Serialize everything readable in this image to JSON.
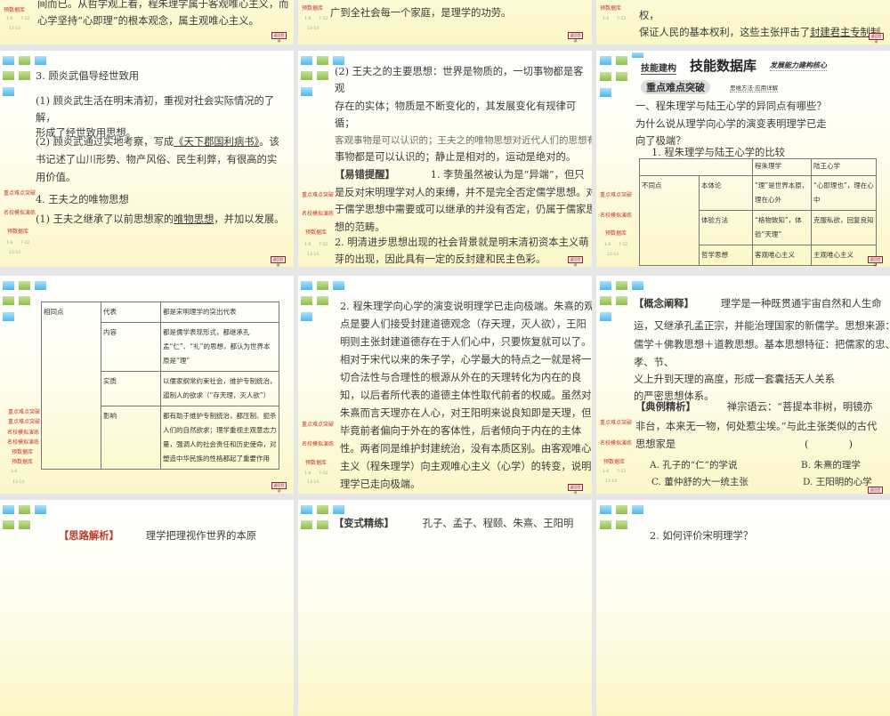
{
  "nav": {
    "key": "重点难点突破",
    "mock": "名校模拟演练",
    "bank": "预数据库",
    "p1": "1-6",
    "p2": "7-12",
    "p3": "13-14",
    "return": "返回目录"
  },
  "s0a": {
    "l1": "间而已。从哲学观上看，程朱理学属于客观唯心主义，而",
    "l2": "心学坚持“心即理”的根本观念，属主观唯心主义。"
  },
  "s0b": {
    "l1": "广到全社会每一个家庭，是理学的功劳。"
  },
  "s0c": {
    "l1": "权，",
    "l2": "保证人民的基本权利，这些主张抨击了",
    "l2u": "封建君主专制制"
  },
  "s1a": {
    "h": "3. 顾炎武倡导经世致用",
    "p1": "(1) 顾炎武生活在明末清初，重视对社会实际情况的了",
    "p1b": "解，",
    "p1c": "形成了经世致用思想。",
    "p2a": "(2) 顾炎武通过实地考察，写成",
    "p2u": "《天下郡国利病书》",
    "p2b": "。该",
    "p2c": "书记述了山川形势、物产风俗、民生利弊，有很高的实",
    "p2d": "用价值。",
    "h2": "4. 王夫之的唯物思想",
    "q1a": "(1) 王夫之继承了以前思想家的",
    "q1u": "唯物思想",
    "q1b": "，并加以发展。"
  },
  "s1b": {
    "l1": "(2) 王夫之的主要思想：世界是物质的，一切事物都是客",
    "l2": "观",
    "l3": "存在的实体；物质是不断变化的，其发展变化有规律可",
    "l4": "循；",
    "l5": "客观事物是可以认识的；王夫之的唯物思想对近代人们的思想有重要影响",
    "l6": "事物都是可以认识的；静止是相对的，运动是绝对的。",
    "l7a": "【易错提醒】",
    "l7b": "1. 李贽虽然被认为是“异端”，但只",
    "l8": "是反对宋明理学对人的束缚，并不是完全否定儒学思想。对",
    "l9": "于儒学思想中需要或可以继承的并没有否定，仍属于儒家思",
    "l10": "想的范畴。",
    "l11": "2. 明清进步思想出现的社会背景就是明末清初资本主义萌",
    "l12": "芽的出现，因此具有一定的反封建和民主色彩。"
  },
  "s1c": {
    "tag1": "技能建构",
    "title": "技能数据库",
    "tag2": "发展能力建构核心",
    "sub": "重点难点突破",
    "sub2": "思维方法·应用详解",
    "q1": "一、程朱理学与陆王心学的异同点有哪些？",
    "q2": "为什么说从理学向心学的演变表明理学已走",
    "q3": "向了极端？",
    "cap": "1. 程朱理学与陆王心学的比较",
    "table": {
      "h1": "程朱理学",
      "h2": "陆王心学",
      "diff": "不同点",
      "r1": "本体论",
      "r1a": "“理”是世界本原，理在心外",
      "r1b": "“心即理也”，理在心中",
      "r2": "体验方法",
      "r2a": "“格物致知”，体验“天理”",
      "r2b": "克服私欲，回复良知",
      "r3": "哲学思想",
      "r3a": "客观唯心主义",
      "r3b": "主观唯心主义"
    }
  },
  "s2a": {
    "same": "相同点",
    "r1": "代表",
    "r1v": "都是宋明理学的突出代表",
    "r2": "内容",
    "r2v": "都是儒学表现形式，都继承孔孟“仁”、“礼”的思想，都认为世界本原是“理”",
    "r3": "实质",
    "r3v": "以儒家纲常约束社会，维护专制统治，遏制人的欲求（“存天理，灭人欲”）",
    "r4": "影响",
    "r4v": "都有助于维护专制统治，都压制、扼杀人们的自然欲求；理学重视主观意志力量，强调人的社会责任和历史使命，对塑造中华民族的性格都起了重要作用"
  },
  "s2b": {
    "lines": [
      "2. 程朱理学向心学的演变说明理学已走向极端。朱熹的观",
      "点是要人们接受封建道德观念（存天理，灭人欲），王阳",
      "明则主张封建道德存在于人们心中，只要恢复就可以了。",
      "相对于宋代以来的朱子学，心学最大的特点之一就是将一",
      "切合法性与合理性的根源从外在的天理转化为内在的良",
      "知，以后者所代表的道德主体性取代前者的权威。虽然对",
      "朱熹而言天理亦在人心，对王阳明来说良知即是天理，但",
      "毕竟前者偏向于外在的客体性，后者倾向于内在的主体",
      "性。两者同是维护封建统治，没有本质区别。由客观唯心",
      "主义（程朱理学）向主观唯心主义（心学）的转变，说明",
      "理学已走向极端。"
    ]
  },
  "s2c": {
    "k": "【概念阐释】",
    "k1": "理学是一种既贯通宇宙自然和人生命",
    "k2": "运，又继承孔孟正宗，并能治理国家的新儒学。思想来源：",
    "k3": "儒学＋佛教思想＋道教思想。基本思想特征：把儒家的忠、",
    "k4": "孝、节、",
    "k5": "义上升到天理的高度，形成一套囊括天人关系",
    "k6": "的严密思想体系。",
    "e": "【典例精析】",
    "e1": "禅宗语云：“菩提本非树，明镜亦",
    "e2": "非台，本来无一物，何处惹尘埃。”与此主张类似的古代",
    "e3": "思想家是",
    "paren": "(　　　　)",
    "A": "A. 孔子的“仁”的学说",
    "B": "B. 朱熹的理学",
    "C": "C. 董仲舒的大一统主张",
    "D": "D. 王阳明的心学"
  },
  "s3a": {
    "l1": "【思路解析】",
    "l2": "理学把理视作世界的本原"
  },
  "s3b": {
    "l1": "【变式精练】",
    "l2": "孔子、孟子、程颐、朱熹、王阳明"
  },
  "s3c": {
    "l1": "2. 如何评价宋明理学？"
  }
}
